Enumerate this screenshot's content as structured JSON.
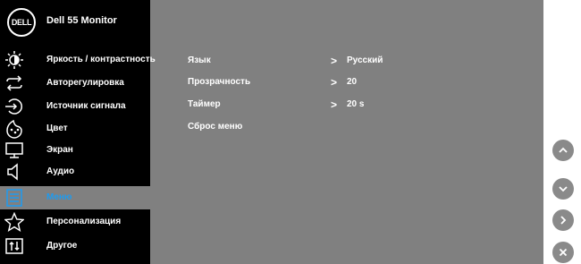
{
  "header": {
    "logo_text": "DELL",
    "title": "Dell 55 Monitor"
  },
  "sidebar": {
    "items": [
      {
        "label": "Яркость / контрастность",
        "icon": "brightness-icon"
      },
      {
        "label": "Авторегулировка",
        "icon": "auto-adjust-icon"
      },
      {
        "label": "Источник сигнала",
        "icon": "input-source-icon"
      },
      {
        "label": "Цвет",
        "icon": "color-icon"
      },
      {
        "label": "Экран",
        "icon": "display-icon"
      },
      {
        "label": "Аудио",
        "icon": "audio-icon"
      },
      {
        "label": "Меню",
        "icon": "menu-icon",
        "active": true
      },
      {
        "label": "Персонализация",
        "icon": "star-icon"
      },
      {
        "label": "Другое",
        "icon": "other-icon"
      }
    ]
  },
  "menu_settings": {
    "rows": [
      {
        "label": "Язык",
        "value": "Русский"
      },
      {
        "label": "Прозрачность",
        "value": "20"
      },
      {
        "label": "Таймер",
        "value": "20 s"
      },
      {
        "label": "Сброс меню",
        "value": ""
      }
    ]
  },
  "colors": {
    "sidebar_bg": "#000000",
    "panel_bg": "#808080",
    "active_item_text": "#1d9bf0",
    "text": "#ffffff",
    "button_bg": "#8a8a8a"
  },
  "buttons": [
    {
      "icon": "chevron-up-icon"
    },
    {
      "icon": "chevron-down-icon"
    },
    {
      "icon": "chevron-right-icon"
    },
    {
      "icon": "close-icon"
    }
  ]
}
